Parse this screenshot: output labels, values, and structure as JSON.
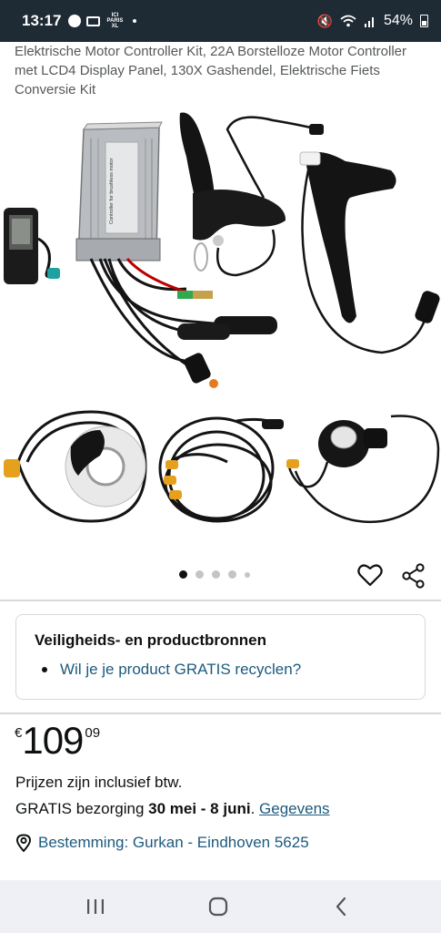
{
  "status_bar": {
    "time": "13:17",
    "brand": "ICI PARIS XL",
    "battery": "54%"
  },
  "product": {
    "title": "Elektrische Motor Controller Kit, 22A Borstelloze Motor Controller met LCD4 Display Panel, 130X Gashendel, Elektrische Fiets Conversie Kit"
  },
  "gallery": {
    "images": [
      "controller-box",
      "lcd4-display",
      "brake-lever-left",
      "brake-lever-right",
      "pas-sensor",
      "cable-harness",
      "throttle"
    ],
    "controller_label": "Controller for brushless motor",
    "page_count": 5,
    "active_index": 0
  },
  "actions": {
    "wishlist_icon": "heart-icon",
    "share_icon": "share-icon"
  },
  "safety": {
    "heading": "Veiligheids- en productbronnen",
    "link": "Wil je je product GRATIS recyclen?"
  },
  "price": {
    "currency": "€",
    "whole": "109",
    "fraction": "09"
  },
  "vat_note": "Prijzen zijn inclusief btw.",
  "delivery": {
    "prefix": "GRATIS bezorging",
    "dates": "30 mei - 8 juni",
    "details_link": "Gegevens"
  },
  "destination": "Bestemming: Gurkan - Eindhoven 5625",
  "colors": {
    "link": "#1c5a7e",
    "status_bar": "#1e2a34",
    "nav_bar": "#eef0f5"
  }
}
